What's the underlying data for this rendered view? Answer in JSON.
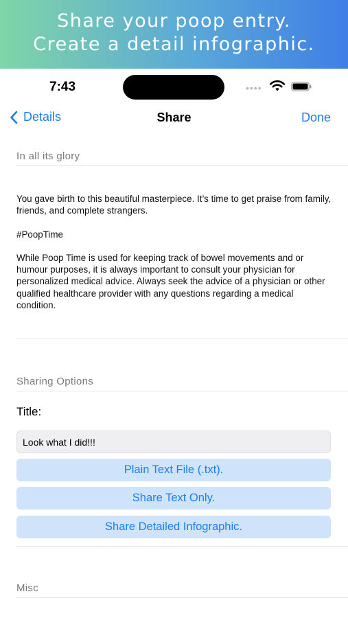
{
  "banner": {
    "line1": "Share your poop entry.",
    "line2": "Create a detail infographic."
  },
  "status_bar": {
    "time": "7:43",
    "signal_icon": "signal-dots-icon",
    "wifi_icon": "wifi-icon",
    "battery_icon": "battery-icon"
  },
  "nav": {
    "back_label": "Details",
    "title": "Share",
    "done_label": "Done"
  },
  "sections": {
    "glory_header": "In all its glory",
    "sharing_header": "Sharing Options",
    "misc_header": "Misc"
  },
  "message": {
    "paragraph1": "You gave birth to this beautiful masterpiece. It’s time to get praise from family, friends, and complete strangers.",
    "hashtag": "#PoopTime",
    "disclaimer": "While Poop Time is used for keeping track of bowel movements and or humour purposes, it is always important to consult your physician for personalized medical advice. Always seek the advice of a physician or other qualified healthcare provider with any questions regarding a medical condition."
  },
  "sharing": {
    "title_label": "Title:",
    "title_value": "Look what I did!!!",
    "buttons": [
      "Plain Text File (.txt).",
      "Share Text Only.",
      "Share Detailed Infographic."
    ]
  },
  "colors": {
    "accent": "#1a7ef2",
    "button_bg": "#cfe3fa",
    "banner_start": "#7fd6a6",
    "banner_end": "#3f7fe6"
  }
}
